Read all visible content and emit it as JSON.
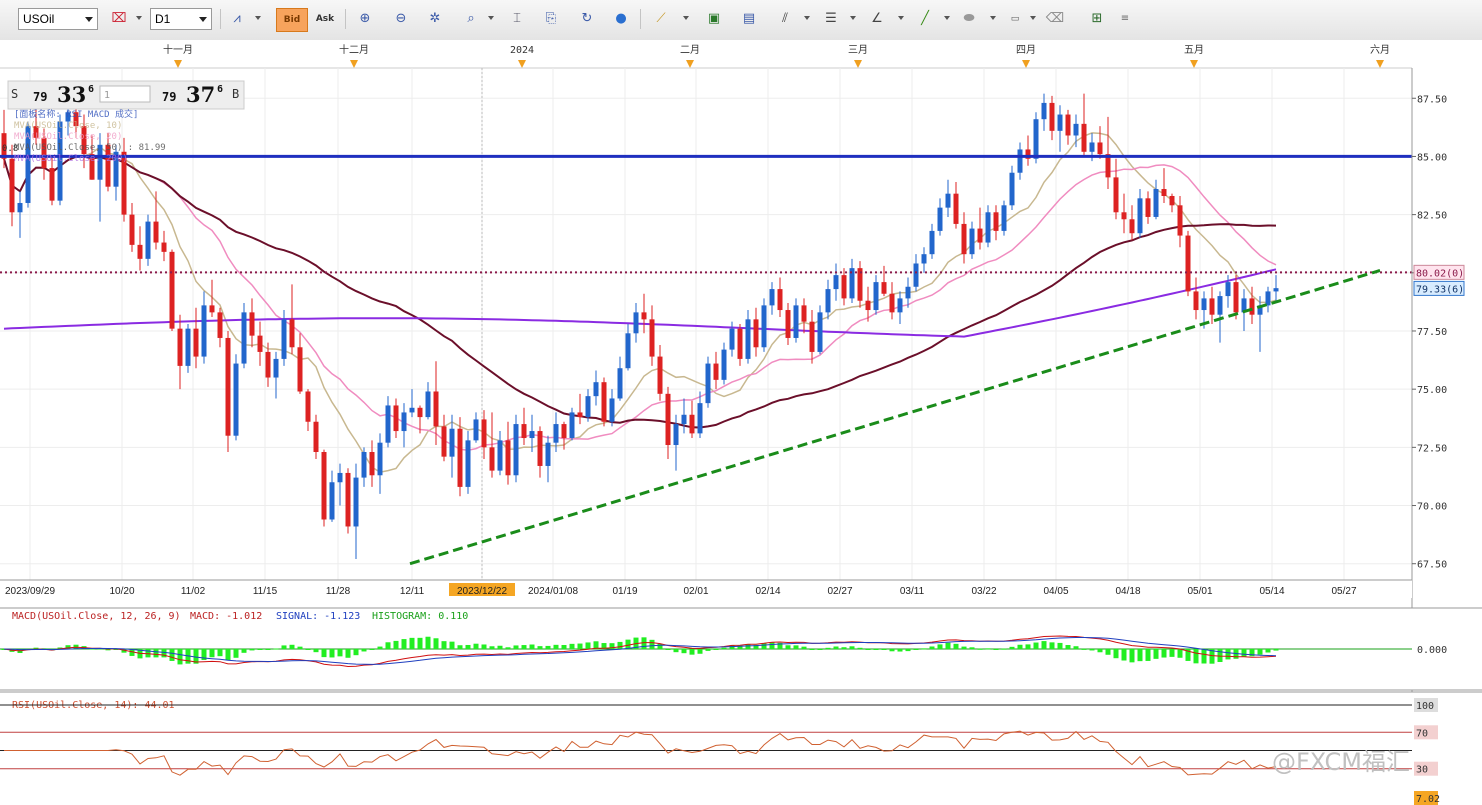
{
  "toolbar": {
    "symbol": "USOil",
    "timeframe": "D1",
    "active_tool_label": "Bid",
    "ask_tool_label": "Ask"
  },
  "quote": {
    "sell_label": "S",
    "sell_big": "79",
    "sell_main": "33",
    "sell_sup": "6",
    "amount": "1",
    "buy_big": "79",
    "buy_main": "37",
    "buy_sup": "6",
    "buy_label": "B"
  },
  "legend": [
    {
      "text": "[面板名称: RSI MACD 成交]",
      "color": "#3355bb"
    },
    {
      "text": "MVA(USOil.Close, 10)",
      "color": "#c8b890"
    },
    {
      "text": "MVA(USOil.Close, 20)",
      "color": "#f0a0c8"
    },
    {
      "text": "MVA(USOil.Close, 50) : 81.99",
      "color": "#555555"
    },
    {
      "text": "MVA(USOil.Close, 200)",
      "color": "#b070e0"
    }
  ],
  "legend_prefix": "0.8",
  "month_markers": [
    "十一月",
    "十二月",
    "2024",
    "二月",
    "三月",
    "四月",
    "五月",
    "六月"
  ],
  "date_labels": [
    "2023/09/29",
    "10/20",
    "11/02",
    "11/15",
    "11/28",
    "12/11",
    "2023/12/22",
    "2024/01/08",
    "01/19",
    "02/01",
    "02/14",
    "02/27",
    "03/11",
    "03/22",
    "04/05",
    "04/18",
    "05/01",
    "05/14",
    "05/27"
  ],
  "price_axis": [
    "87.50",
    "85.00",
    "82.50",
    "80.00",
    "77.50",
    "75.00",
    "72.50",
    "70.00",
    "67.50"
  ],
  "price_tags": {
    "resistance": "80.02(0)",
    "current": "79.33(6)"
  },
  "macd": {
    "title": "MACD(USOil.Close, 12, 26, 9)",
    "value_label": "MACD: -1.012",
    "signal_label": "SIGNAL: -1.123",
    "hist_label": "HISTOGRAM: 0.110",
    "zero_label": "0.000"
  },
  "rsi": {
    "title": "RSI(USOil.Close, 14): 44.01",
    "axis": [
      "100",
      "70",
      "30",
      "7.02"
    ]
  },
  "watermark": "@FXCM福汇",
  "colors": {
    "bull": "#2266cc",
    "bear": "#dd2222",
    "ma10": "#c8b890",
    "ma20": "#f08cc0",
    "ma50": "#6b0f2a",
    "ma200": "#8a2be2",
    "resistance": "#1f2fbf",
    "trend": "#1a8c1a",
    "dotted": "#8b1a4a"
  },
  "chart_data": {
    "type": "candlestick",
    "period": "D1",
    "horizontal_line": 85.0,
    "dotted_line": 80.02,
    "trendline": {
      "from": [
        "12/11",
        67.5
      ],
      "to": [
        "05/27",
        80.1
      ]
    },
    "ylim": [
      66.8,
      88.8
    ],
    "ohlc": [
      [
        86.0,
        87.0,
        84.5,
        84.9
      ],
      [
        84.9,
        85.5,
        82.0,
        82.6
      ],
      [
        82.6,
        83.5,
        81.5,
        83.0
      ],
      [
        83.0,
        86.5,
        82.8,
        86.3
      ],
      [
        86.3,
        87.3,
        85.5,
        85.8
      ],
      [
        85.8,
        86.2,
        84.0,
        84.5
      ],
      [
        84.5,
        85.0,
        82.9,
        83.1
      ],
      [
        83.1,
        86.8,
        82.9,
        86.5
      ],
      [
        86.5,
        87.5,
        85.9,
        86.9
      ],
      [
        86.9,
        87.4,
        85.8,
        86.3
      ],
      [
        86.3,
        86.8,
        84.5,
        85.1
      ],
      [
        85.1,
        85.9,
        84.0,
        84.0
      ],
      [
        84.0,
        86.0,
        82.2,
        85.5
      ],
      [
        85.5,
        86.0,
        83.5,
        83.7
      ],
      [
        83.7,
        85.5,
        83.1,
        85.2
      ],
      [
        85.2,
        85.8,
        82.2,
        82.5
      ],
      [
        82.5,
        83.0,
        80.9,
        81.2
      ],
      [
        81.2,
        82.0,
        80.1,
        80.6
      ],
      [
        80.6,
        82.5,
        80.3,
        82.2
      ],
      [
        82.2,
        83.5,
        81.0,
        81.3
      ],
      [
        81.3,
        81.8,
        80.5,
        80.9
      ],
      [
        80.9,
        81.0,
        77.5,
        77.6
      ],
      [
        77.6,
        78.2,
        75.0,
        76.0
      ],
      [
        76.0,
        77.8,
        75.7,
        77.6
      ],
      [
        77.6,
        78.5,
        75.9,
        76.4
      ],
      [
        76.4,
        79.2,
        76.1,
        78.6
      ],
      [
        78.6,
        79.7,
        78.1,
        78.3
      ],
      [
        78.3,
        78.5,
        76.8,
        77.2
      ],
      [
        77.2,
        77.5,
        72.3,
        73.0
      ],
      [
        73.0,
        76.5,
        72.8,
        76.1
      ],
      [
        76.1,
        78.7,
        75.9,
        78.3
      ],
      [
        78.3,
        78.9,
        76.8,
        77.3
      ],
      [
        77.3,
        77.9,
        76.0,
        76.6
      ],
      [
        76.6,
        77.0,
        75.1,
        75.5
      ],
      [
        75.5,
        76.6,
        74.6,
        76.3
      ],
      [
        76.3,
        78.4,
        76.0,
        78.0
      ],
      [
        78.0,
        79.5,
        76.5,
        76.8
      ],
      [
        76.8,
        77.4,
        74.8,
        74.9
      ],
      [
        74.9,
        75.0,
        73.2,
        73.6
      ],
      [
        73.6,
        73.9,
        72.0,
        72.3
      ],
      [
        72.3,
        72.4,
        69.1,
        69.4
      ],
      [
        69.4,
        71.5,
        69.3,
        71.0
      ],
      [
        71.0,
        71.8,
        70.0,
        71.4
      ],
      [
        71.4,
        71.6,
        68.8,
        69.1
      ],
      [
        69.1,
        71.8,
        67.7,
        71.2
      ],
      [
        71.2,
        72.5,
        70.8,
        72.3
      ],
      [
        72.3,
        72.8,
        70.8,
        71.3
      ],
      [
        71.3,
        73.1,
        70.5,
        72.7
      ],
      [
        72.7,
        74.7,
        72.5,
        74.3
      ],
      [
        74.3,
        74.6,
        72.9,
        73.2
      ],
      [
        73.2,
        74.4,
        72.5,
        74.0
      ],
      [
        74.0,
        75.0,
        73.8,
        74.2
      ],
      [
        74.2,
        74.3,
        73.1,
        73.8
      ],
      [
        73.8,
        75.3,
        73.7,
        74.9
      ],
      [
        74.9,
        76.2,
        72.6,
        73.4
      ],
      [
        73.4,
        73.9,
        71.9,
        72.1
      ],
      [
        72.1,
        73.9,
        71.2,
        73.3
      ],
      [
        73.3,
        73.8,
        70.4,
        70.8
      ],
      [
        70.8,
        73.2,
        70.5,
        72.8
      ],
      [
        72.8,
        74.0,
        72.7,
        73.7
      ],
      [
        73.7,
        74.1,
        72.0,
        72.5
      ],
      [
        72.5,
        74.0,
        71.2,
        71.5
      ],
      [
        71.5,
        73.2,
        71.3,
        72.8
      ],
      [
        72.8,
        73.6,
        70.9,
        71.3
      ],
      [
        71.3,
        73.9,
        71.0,
        73.5
      ],
      [
        73.5,
        74.2,
        72.6,
        72.9
      ],
      [
        72.9,
        73.9,
        72.3,
        73.2
      ],
      [
        73.2,
        73.4,
        71.2,
        71.7
      ],
      [
        71.7,
        73.0,
        71.0,
        72.7
      ],
      [
        72.7,
        74.0,
        72.3,
        73.5
      ],
      [
        73.5,
        73.6,
        72.4,
        72.9
      ],
      [
        72.9,
        74.2,
        72.8,
        74.0
      ],
      [
        74.0,
        74.8,
        73.5,
        73.8
      ],
      [
        73.8,
        75.0,
        73.6,
        74.7
      ],
      [
        74.7,
        75.8,
        74.3,
        75.3
      ],
      [
        75.3,
        75.5,
        73.4,
        73.6
      ],
      [
        73.6,
        75.0,
        73.4,
        74.6
      ],
      [
        74.6,
        76.4,
        74.5,
        75.9
      ],
      [
        75.9,
        77.8,
        75.8,
        77.4
      ],
      [
        77.4,
        78.7,
        77.0,
        78.3
      ],
      [
        78.3,
        79.1,
        77.4,
        78.0
      ],
      [
        78.0,
        78.6,
        76.0,
        76.4
      ],
      [
        76.4,
        76.9,
        74.5,
        74.8
      ],
      [
        74.8,
        75.1,
        72.0,
        72.6
      ],
      [
        72.6,
        73.9,
        71.5,
        73.5
      ],
      [
        73.5,
        74.6,
        73.1,
        73.9
      ],
      [
        73.9,
        74.5,
        72.9,
        73.1
      ],
      [
        73.1,
        74.9,
        72.9,
        74.4
      ],
      [
        74.4,
        76.4,
        74.2,
        76.1
      ],
      [
        76.1,
        76.6,
        75.0,
        75.4
      ],
      [
        75.4,
        77.0,
        75.2,
        76.7
      ],
      [
        76.7,
        77.9,
        76.4,
        77.6
      ],
      [
        77.6,
        77.8,
        76.0,
        76.3
      ],
      [
        76.3,
        78.4,
        76.1,
        78.0
      ],
      [
        78.0,
        78.5,
        76.4,
        76.8
      ],
      [
        76.8,
        78.9,
        76.6,
        78.6
      ],
      [
        78.6,
        79.6,
        78.2,
        79.3
      ],
      [
        79.3,
        79.8,
        78.1,
        78.4
      ],
      [
        78.4,
        78.7,
        76.9,
        77.2
      ],
      [
        77.2,
        78.9,
        77.0,
        78.6
      ],
      [
        78.6,
        78.9,
        77.4,
        77.9
      ],
      [
        77.9,
        78.4,
        76.1,
        76.6
      ],
      [
        76.6,
        78.6,
        76.5,
        78.3
      ],
      [
        78.3,
        79.7,
        78.0,
        79.3
      ],
      [
        79.3,
        80.4,
        78.8,
        79.9
      ],
      [
        79.9,
        80.2,
        78.6,
        78.9
      ],
      [
        78.9,
        80.6,
        78.7,
        80.2
      ],
      [
        80.2,
        80.5,
        78.5,
        78.8
      ],
      [
        78.8,
        79.4,
        77.9,
        78.4
      ],
      [
        78.4,
        79.9,
        78.2,
        79.6
      ],
      [
        79.6,
        80.3,
        79.0,
        79.1
      ],
      [
        79.1,
        79.6,
        78.0,
        78.3
      ],
      [
        78.3,
        79.2,
        77.8,
        78.9
      ],
      [
        78.9,
        79.8,
        78.5,
        79.4
      ],
      [
        79.4,
        80.8,
        79.2,
        80.4
      ],
      [
        80.4,
        81.1,
        80.0,
        80.8
      ],
      [
        80.8,
        82.1,
        80.6,
        81.8
      ],
      [
        81.8,
        83.2,
        81.6,
        82.8
      ],
      [
        82.8,
        84.0,
        82.4,
        83.4
      ],
      [
        83.4,
        83.9,
        81.9,
        82.1
      ],
      [
        82.1,
        82.6,
        80.4,
        80.8
      ],
      [
        80.8,
        82.2,
        80.6,
        81.9
      ],
      [
        81.9,
        82.8,
        81.0,
        81.3
      ],
      [
        81.3,
        82.9,
        81.1,
        82.6
      ],
      [
        82.6,
        82.9,
        81.4,
        81.8
      ],
      [
        81.8,
        83.1,
        81.6,
        82.9
      ],
      [
        82.9,
        84.6,
        82.7,
        84.3
      ],
      [
        84.3,
        85.6,
        84.0,
        85.3
      ],
      [
        85.3,
        85.9,
        84.6,
        84.9
      ],
      [
        84.9,
        86.9,
        84.7,
        86.6
      ],
      [
        86.6,
        87.7,
        86.1,
        87.3
      ],
      [
        87.3,
        87.6,
        85.7,
        86.1
      ],
      [
        86.1,
        87.2,
        85.2,
        86.8
      ],
      [
        86.8,
        87.0,
        85.5,
        85.9
      ],
      [
        85.9,
        86.8,
        85.4,
        86.4
      ],
      [
        86.4,
        87.7,
        85.0,
        85.2
      ],
      [
        85.2,
        86.0,
        84.8,
        85.6
      ],
      [
        85.6,
        86.3,
        84.9,
        85.1
      ],
      [
        85.1,
        86.7,
        83.6,
        84.1
      ],
      [
        84.1,
        84.9,
        82.3,
        82.6
      ],
      [
        82.6,
        83.4,
        81.7,
        82.3
      ],
      [
        82.3,
        82.9,
        81.4,
        81.7
      ],
      [
        81.7,
        83.6,
        81.5,
        83.2
      ],
      [
        83.2,
        83.5,
        82.1,
        82.4
      ],
      [
        82.4,
        84.0,
        82.3,
        83.6
      ],
      [
        83.6,
        84.5,
        83.0,
        83.3
      ],
      [
        83.3,
        83.4,
        82.6,
        82.9
      ],
      [
        82.9,
        83.3,
        81.1,
        81.6
      ],
      [
        81.6,
        81.8,
        79.0,
        79.2
      ],
      [
        79.2,
        79.8,
        78.0,
        78.4
      ],
      [
        78.4,
        79.2,
        77.6,
        78.9
      ],
      [
        78.9,
        79.4,
        77.8,
        78.2
      ],
      [
        78.2,
        79.2,
        77.0,
        79.0
      ],
      [
        79.0,
        79.9,
        78.5,
        79.6
      ],
      [
        79.6,
        79.9,
        78.0,
        78.3
      ],
      [
        78.3,
        79.3,
        77.5,
        78.9
      ],
      [
        78.9,
        79.4,
        77.8,
        78.2
      ],
      [
        78.2,
        79.0,
        76.6,
        78.6
      ],
      [
        78.6,
        79.4,
        78.3,
        79.2
      ],
      [
        79.2,
        79.9,
        78.8,
        79.34
      ]
    ]
  }
}
